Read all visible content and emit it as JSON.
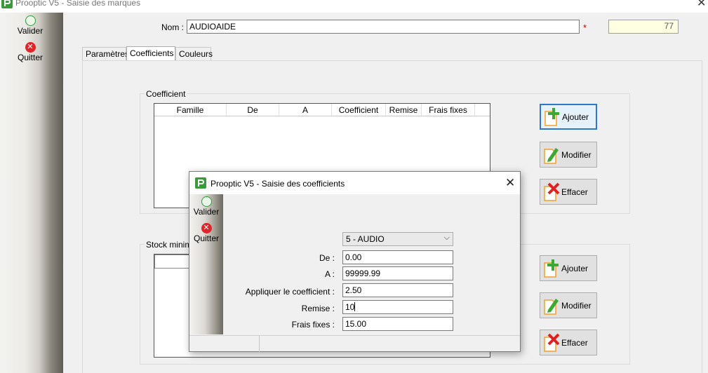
{
  "window": {
    "title": "Prooptic V5 - Saisie des marques"
  },
  "sidebar": {
    "validate_label": "Valider",
    "quit_label": "Quitter"
  },
  "form": {
    "name_label": "Nom :",
    "name_value": "AUDIOAIDE",
    "required_marker": "*",
    "counter_value": "77"
  },
  "tabs": [
    {
      "label": "Paramètres",
      "active": false
    },
    {
      "label": "Coefficients",
      "active": true
    },
    {
      "label": "Couleurs",
      "active": false
    }
  ],
  "coefficient_group": {
    "title": "Coefficient",
    "columns": [
      "Famille",
      "De",
      "A",
      "Coefficient",
      "Remise",
      "Frais fixes"
    ]
  },
  "stock_group": {
    "title": "Stock minimum"
  },
  "actions": {
    "add_label": "Ajouter",
    "edit_label": "Modifier",
    "delete_label": "Effacer"
  },
  "dialog": {
    "title": "Prooptic V5 - Saisie des coefficients",
    "validate_label": "Valider",
    "quit_label": "Quitter",
    "family_selected": "5 - AUDIO",
    "from_label": "De :",
    "from_value": "0.00",
    "to_label": "A :",
    "to_value": "99999.99",
    "coef_label": "Appliquer le coefficient :",
    "coef_value": "2.50",
    "discount_label": "Remise :",
    "discount_value": "10",
    "fees_label": "Frais fixes :",
    "fees_value": "15.00"
  },
  "colors": {
    "accent": "#2f78c8",
    "required": "#c00000",
    "add_icon": "#3aaa35",
    "delete_icon": "#e02020",
    "doc_outline": "#f0a030"
  },
  "icons": {
    "app": "prooptic-logo-icon",
    "validate": "green-circle-icon",
    "quit": "red-x-circle-icon",
    "add": "document-plus-icon",
    "edit": "document-pencil-icon",
    "delete": "document-x-icon",
    "dropdown": "chevron-down-icon",
    "close": "close-icon"
  }
}
